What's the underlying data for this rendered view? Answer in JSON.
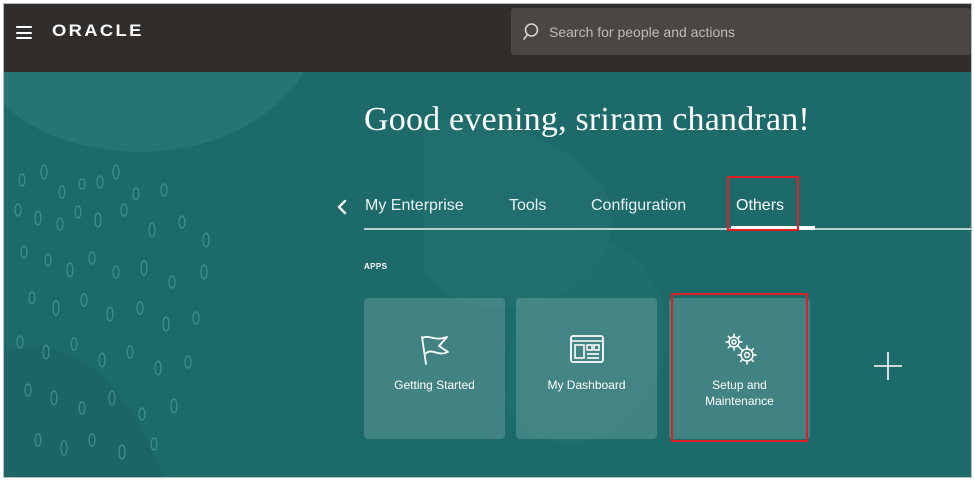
{
  "header": {
    "brand": "ORACLE",
    "search_placeholder": "Search for people and actions"
  },
  "greeting": "Good evening, sriram chandran!",
  "tabs": [
    {
      "label": "My Enterprise"
    },
    {
      "label": "Tools"
    },
    {
      "label": "Configuration"
    },
    {
      "label": "Others",
      "active": true
    }
  ],
  "apps": {
    "section_label": "APPS",
    "tiles": [
      {
        "label": "Getting Started",
        "icon": "flag-icon"
      },
      {
        "label": "My Dashboard",
        "icon": "dashboard-icon"
      },
      {
        "label": "Setup and Maintenance",
        "icon": "gears-icon"
      }
    ],
    "add_icon": "plus-icon"
  },
  "colors": {
    "header_bg": "#312d2a",
    "hero_bg": "#1d6a6b",
    "highlight": "#e01f25"
  }
}
